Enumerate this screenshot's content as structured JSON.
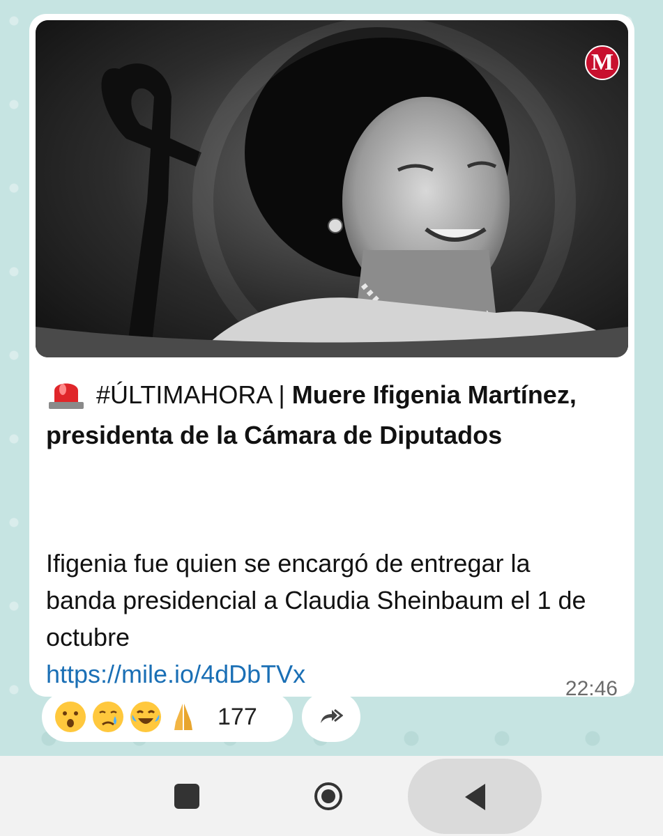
{
  "post": {
    "hashtag": "#ÚLTIMAHORA",
    "separator": " | ",
    "headline_bold": "Muere Ifigenia Martínez, presidenta de la Cámara de Diputados",
    "body": "Ifigenia fue quien se encargó de entregar la banda presidencial a Claudia Sheinbaum el 1 de octubre",
    "link": "https://mile.io/4dDbTVx",
    "time": "22:46",
    "logo_letter": "M"
  },
  "reactions": {
    "emojis": [
      "surprised-face",
      "crying-face",
      "tears-of-joy-face",
      "folded-hands"
    ],
    "count": "177"
  },
  "colors": {
    "wallpaper": "#c6e4e2",
    "link": "#1a6fb5",
    "logo": "#c8102e"
  },
  "navbar": {
    "icons": [
      "recents-square-icon",
      "home-circle-icon",
      "back-triangle-icon"
    ]
  }
}
